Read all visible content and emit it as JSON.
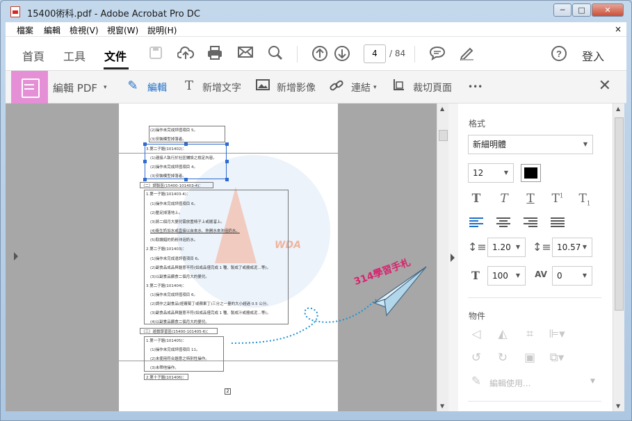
{
  "window": {
    "title": "15400術科.pdf - Adobe Acrobat Pro DC",
    "minimize": "─",
    "maximize": "□",
    "close": "✕"
  },
  "menu": {
    "items": [
      "檔案",
      "編輯",
      "檢視(V)",
      "視窗(W)",
      "說明(H)"
    ],
    "close": "×"
  },
  "toolbar": {
    "home": "首頁",
    "tools": "工具",
    "document": "文件",
    "page_current": "4",
    "page_total": "/ 84",
    "login": "登入",
    "icons": [
      "save-icon",
      "upload-icon",
      "print-icon",
      "mail-icon",
      "search-icon",
      "page-up-icon",
      "page-down-icon",
      "comment-icon",
      "sign-icon",
      "help-icon"
    ]
  },
  "editbar": {
    "title": "編輯 PDF",
    "edit": "編輯",
    "add_text": "新增文字",
    "add_image": "新增影像",
    "link": "連結",
    "crop": "裁切頁面",
    "more": "•••",
    "close": "✕"
  },
  "document": {
    "lines": [
      "(2)操作未完成評值項目 5。",
      "(3)安裝模型掉落者。",
      "3.第二子題(101402)：",
      "(1)連接人執行於社區鋪設之檢定內容。",
      "(2)操作未完成評值項目 4。",
      "(3)安裝模型掉落者。",
      "（二）調製區(15400-101403-4)：",
      "1.第一子題(101403-4)：",
      "(1)操作未完成評值項目 6。",
      "(2)壓足掉落地上。",
      "(3)將二個月大嬰兒需放置椅子上或擺溜上。",
      "(4)衛生奶加水或直接以自來水、熱開水來沖泡奶水。",
      "(5)取讀錯的奶粉沖泡奶水。",
      "2.第二子題(101403)：",
      "(1)操作未完成違評值項目 6。",
      "(2)副食品成品與題意不符(如成品僅完成 1 種、製成了或攪成泥…等)。",
      "(3)以副食品餵食二個月大的嬰兒。",
      "3.第二子題(101404)：",
      "(1)操作未完成評值項目 6。",
      "(2)調作之副食品(經蘿蔔丁或蘋果丁)三分之一量的大小超過 0.5 公分。",
      "(3)副食品成品與題意不符(如成品僅完成 1 種、製成汁或攪成泥…等)。",
      "(4)以副食品餵食二個月大的嬰兒。",
      "（三）遊戲學習區(15400-101405-6)：",
      "1.第一子題(101405)：",
      "(1)操作未完成評值項目 11。",
      "(2)未使用符合題意之特別性操作。",
      "(3)未帶他操作。",
      "2.第十子題(101406)："
    ],
    "page_number": "2",
    "watermark_brand": "WDA",
    "overlay_text": "314學習手札"
  },
  "format_panel": {
    "section_format": "格式",
    "font": "新細明體",
    "font_size": "12",
    "color": "#000000",
    "line_spacing": "1.20",
    "paragraph_spacing": "10.57",
    "horizontal_scale": "100",
    "char_spacing": "0",
    "section_objects": "物件",
    "edit_using": "編輯使用..."
  }
}
